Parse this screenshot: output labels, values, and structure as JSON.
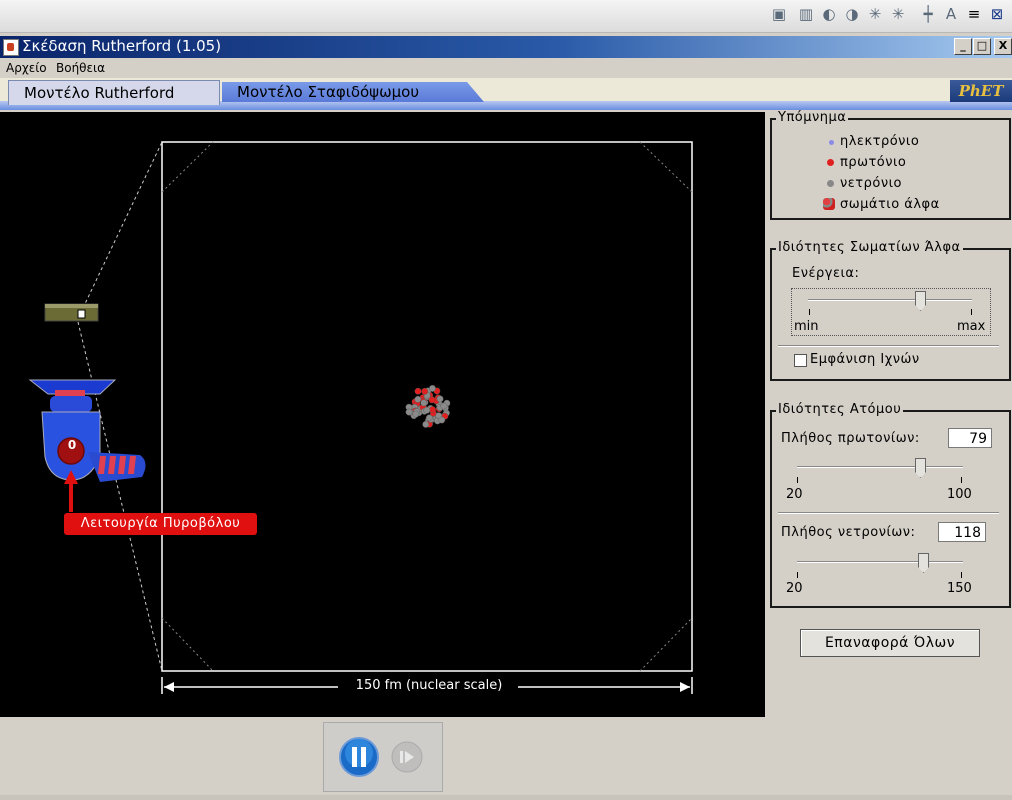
{
  "window": {
    "title": "Σκέδαση Rutherford (1.05)",
    "buttons": {
      "minimize": "_",
      "maximize": "□",
      "close": "X"
    }
  },
  "menu": {
    "file": "Αρχείο",
    "help": "Βοήθεια"
  },
  "tabs": [
    {
      "label": "Μοντέλο Rutherford",
      "selected": true
    },
    {
      "label": "Μοντέλο Σταφιδόψωμου",
      "selected": false
    }
  ],
  "logo": "PhET",
  "simulation": {
    "gun_counter": "0",
    "gun_label": "Λειτουργία Πυροβόλου",
    "scale_label": "150 fm (nuclear scale)"
  },
  "legend": {
    "title": "Υπόμνημα",
    "items": [
      {
        "label": "ηλεκτρόνιο",
        "icon": "electron-icon",
        "color": "#8a8ae8"
      },
      {
        "label": "πρωτόνιο",
        "icon": "proton-icon",
        "color": "#e02020"
      },
      {
        "label": "νετρόνιο",
        "icon": "neutron-icon",
        "color": "#888888"
      },
      {
        "label": "σωμάτιο άλφα",
        "icon": "alpha-particle-icon",
        "color": "#d04040"
      }
    ]
  },
  "alpha_props": {
    "title": "Ιδιότητες Σωματίων Άλφα",
    "energy_label": "Ενέργεια:",
    "energy_level": 0.75,
    "min_label": "min",
    "max_label": "max",
    "show_traces_label": "Εμφάνιση Ιχνών",
    "show_traces_checked": false
  },
  "atom_props": {
    "title": "Ιδιότητες Ατόμου",
    "protons_label": "Πλήθος πρωτονίων:",
    "protons_value": "79",
    "protons_min": "20",
    "protons_max": "100",
    "neutrons_label": "Πλήθος νετρονίων:",
    "neutrons_value": "118",
    "neutrons_min": "20",
    "neutrons_max": "150"
  },
  "reset_label": "Επαναφορά Όλων",
  "colors": {
    "accent_tab": "#5a7ad8",
    "gun_label_bg": "#e01010",
    "pause_button": "#2a7ad0"
  }
}
